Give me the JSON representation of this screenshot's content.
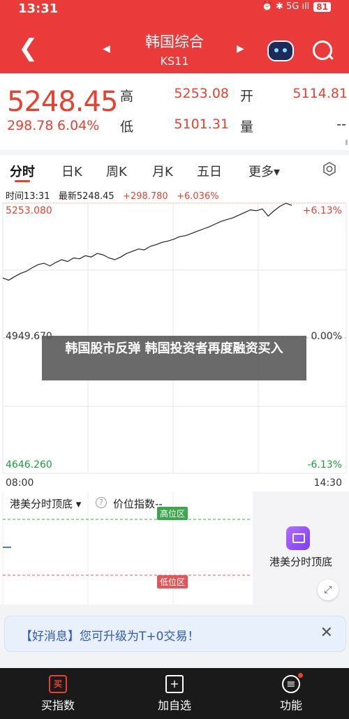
{
  "status": {
    "time": "13:31",
    "signal": "⏰ ✱ 5G ıll",
    "battery": "81"
  },
  "header": {
    "title": "韩国综合",
    "code": "KS11"
  },
  "quote": {
    "price": "5248.45",
    "change": "298.78",
    "change_pct": "6.04%",
    "high_label": "高",
    "high": "5253.08",
    "open_label": "开",
    "open": "5114.81",
    "low_label": "低",
    "low": "5101.31",
    "volume_label": "量",
    "volume": "--"
  },
  "tabs": [
    "分时",
    "日K",
    "周K",
    "月K",
    "五日",
    "更多▾"
  ],
  "chart_info": {
    "time": "时间13:31",
    "latest": "最新5248.45",
    "change": "+298.780",
    "pct": "+6.036%"
  },
  "chart_data": {
    "type": "line",
    "x_start": "08:00",
    "x_end": "14:30",
    "y_max": 5253.08,
    "y_mid": 4949.67,
    "y_min": 4646.26,
    "y_max_label": "5253.080",
    "y_mid_label": "4949.670",
    "y_min_label": "4646.260",
    "pct_max_label": "+6.13%",
    "pct_mid_label": "0.00%",
    "pct_min_label": "-6.13%",
    "values": [
      5085,
      5080,
      5088,
      5095,
      5100,
      5108,
      5115,
      5118,
      5112,
      5120,
      5126,
      5122,
      5130,
      5128,
      5135,
      5132,
      5140,
      5137,
      5130,
      5126,
      5132,
      5140,
      5145,
      5150,
      5148,
      5156,
      5160,
      5165,
      5168,
      5172,
      5178,
      5180,
      5185,
      5190,
      5195,
      5200,
      5206,
      5212,
      5216,
      5220,
      5226,
      5232,
      5238,
      5236,
      5240,
      5224,
      5236,
      5246,
      5253,
      5248
    ]
  },
  "overlay": {
    "headline": "韩国股市反弹 韩国投资者再度融资买入"
  },
  "indicator": {
    "selector": "港美分时顶底 ▾",
    "help": "?",
    "name": "价位指数--",
    "high_zone": "高位区",
    "low_zone": "低位区",
    "promo_label": "港美分时顶底"
  },
  "banner": {
    "text": "【好消息】您可升级为T+0交易！",
    "close": "✕"
  },
  "bottom_nav": [
    {
      "icon": "买",
      "label": "买指数"
    },
    {
      "icon": "+",
      "label": "加自选"
    },
    {
      "icon": "≡",
      "label": "功能"
    }
  ]
}
